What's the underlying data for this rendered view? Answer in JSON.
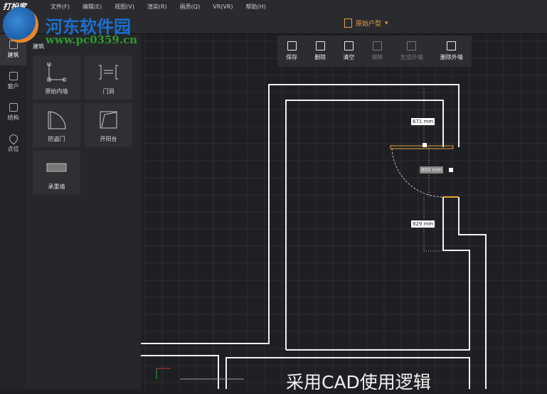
{
  "app": {
    "logo": "打扮家"
  },
  "menu": [
    "文件(F)",
    "编辑(E)",
    "视图(V)",
    "渲染(R)",
    "画质(Q)",
    "VR(VR)",
    "帮助(H)"
  ],
  "plan_select": {
    "label": "原始户型"
  },
  "watermark": {
    "title": "河东软件园",
    "url": "www.pc0359.cn"
  },
  "rail": [
    {
      "label": "建筑",
      "icon": "door-icon",
      "active": true
    },
    {
      "label": "窗户",
      "icon": "window-icon"
    },
    {
      "label": "结构",
      "icon": "cube-icon"
    },
    {
      "label": "点位",
      "icon": "location-pin-icon"
    }
  ],
  "panel": {
    "title": "建筑",
    "tiles": [
      "原始内墙",
      "门洞",
      "防盗门",
      "开阳台",
      "承重墙"
    ]
  },
  "toolbar": [
    {
      "label": "保存",
      "icon": "save-icon",
      "enabled": true
    },
    {
      "label": "删除",
      "icon": "trash-icon",
      "enabled": true
    },
    {
      "label": "清空",
      "icon": "broom-icon",
      "enabled": true
    },
    {
      "label": "偏移",
      "icon": "offset-icon",
      "enabled": false
    },
    {
      "label": "生成外墙",
      "icon": "generate-wall-icon",
      "enabled": false
    },
    {
      "label": "删除外墙",
      "icon": "delete-wall-icon",
      "enabled": true
    }
  ],
  "dimensions": {
    "top": "671 mm",
    "door": "800 mm",
    "bottom": "829 mm"
  },
  "subtitle": "采用CAD使用逻辑",
  "colors": {
    "accent": "#e8a040",
    "background": "#1e1f23",
    "wall": "#ffffff"
  }
}
